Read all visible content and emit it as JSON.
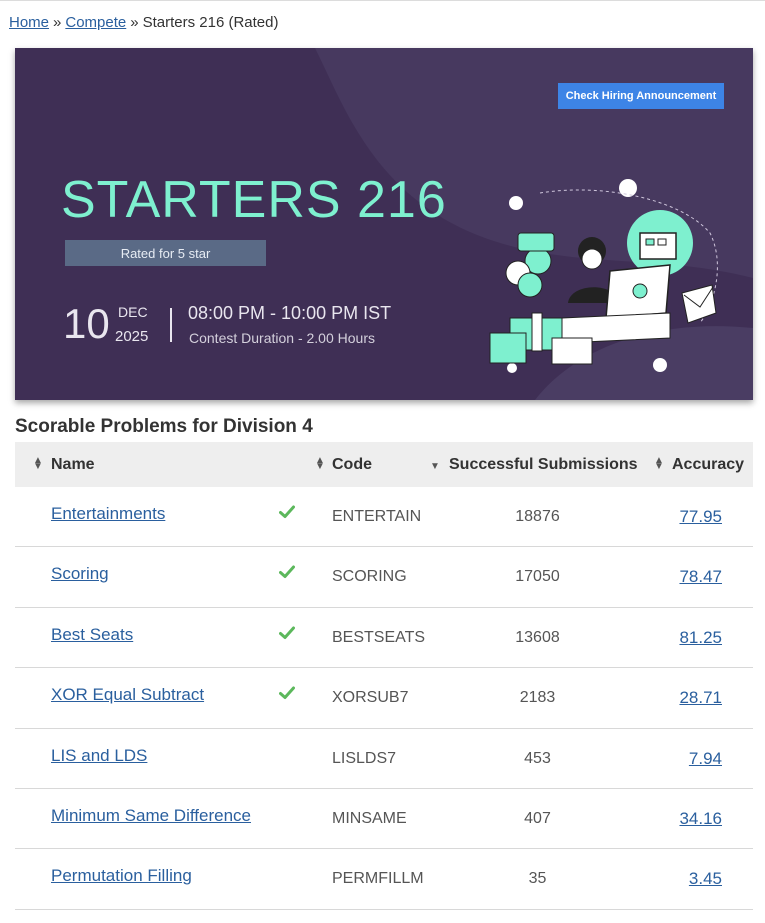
{
  "breadcrumb": {
    "home": "Home",
    "sep": "»",
    "compete": "Compete",
    "current": "Starters 216 (Rated)"
  },
  "banner": {
    "hiring_button": "Check Hiring Announcement",
    "title": "STARTERS 216",
    "rated": "Rated for 5 star",
    "day": "10",
    "month": "DEC",
    "year": "2025",
    "time": "08:00 PM - 10:00 PM IST",
    "duration": "Contest Duration - 2.00 Hours",
    "colors": {
      "background": "#3f2f55",
      "title": "#7ef0cf",
      "button": "#3d84e6"
    }
  },
  "section_title": "Scorable Problems for Division 4",
  "table": {
    "headers": {
      "name": "Name",
      "code": "Code",
      "subs": "Successful Submissions",
      "accuracy": "Accuracy"
    },
    "rows": [
      {
        "name": "Entertainments",
        "solved": true,
        "code": "ENTERTAIN",
        "subs": "18876",
        "accuracy": "77.95"
      },
      {
        "name": "Scoring",
        "solved": true,
        "code": "SCORING",
        "subs": "17050",
        "accuracy": "78.47"
      },
      {
        "name": "Best Seats",
        "solved": true,
        "code": "BESTSEATS",
        "subs": "13608",
        "accuracy": "81.25"
      },
      {
        "name": "XOR Equal Subtract",
        "solved": true,
        "code": "XORSUB7",
        "subs": "2183",
        "accuracy": "28.71"
      },
      {
        "name": "LIS and LDS",
        "solved": false,
        "code": "LISLDS7",
        "subs": "453",
        "accuracy": "7.94"
      },
      {
        "name": "Minimum Same Difference",
        "solved": false,
        "code": "MINSAME",
        "subs": "407",
        "accuracy": "34.16"
      },
      {
        "name": "Permutation Filling",
        "solved": false,
        "code": "PERMFILLM",
        "subs": "35",
        "accuracy": "3.45"
      }
    ]
  },
  "colors": {
    "link": "#2a5f9e",
    "check": "#5cb85c",
    "header_bg": "#eeeeee"
  }
}
